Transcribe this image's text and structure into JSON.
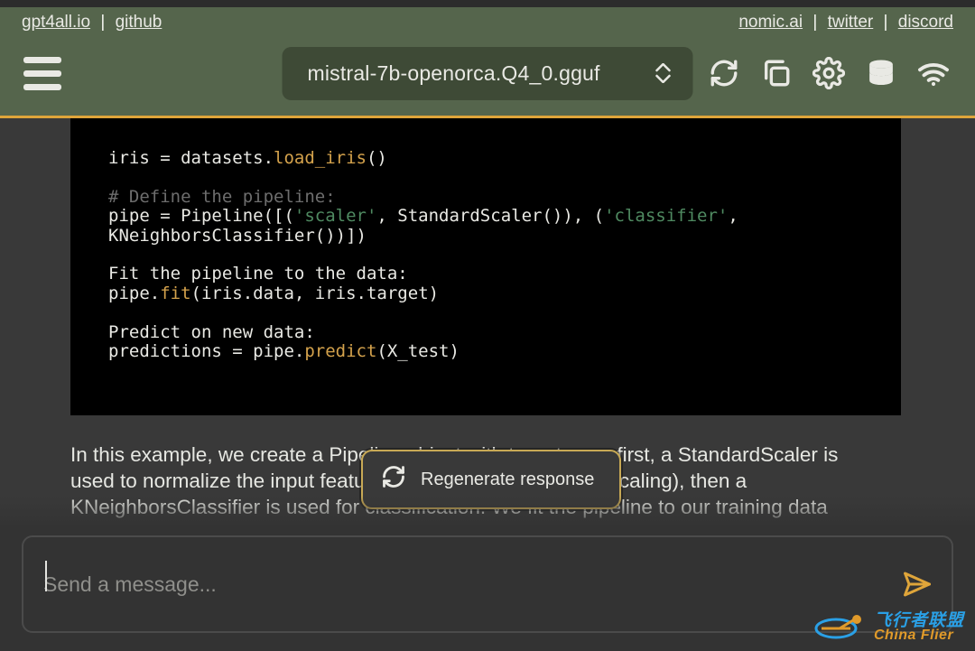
{
  "header": {
    "links_left": [
      {
        "label": "gpt4all.io"
      },
      {
        "label": "github"
      }
    ],
    "links_right": [
      {
        "label": "nomic.ai"
      },
      {
        "label": "twitter"
      },
      {
        "label": "discord"
      }
    ],
    "link_sep": " | ",
    "model_name": "mistral-7b-openorca.Q4_0.gguf",
    "toolbar_icons": [
      "refresh-icon",
      "copy-icon",
      "gear-icon",
      "database-icon",
      "wifi-icon"
    ]
  },
  "code": {
    "l1a": "iris = datasets.",
    "l1b": "load_iris",
    "l1c": "()",
    "l_blank": "",
    "l2": "# Define the pipeline:",
    "l3a": "pipe = Pipeline([(",
    "l3b": "'scaler'",
    "l3c": ", StandardScaler()), (",
    "l3d": "'classifier'",
    "l3e": ",",
    "l4": "KNeighborsClassifier())])",
    "l5": "Fit the pipeline to the data:",
    "l6a": "pipe.",
    "l6b": "fit",
    "l6c": "(iris.data, iris.target)",
    "l7": "Predict on new data:",
    "l8a": "predictions = pipe.",
    "l8b": "predict",
    "l8c": "(X_test)"
  },
  "explain_text": "In this example, we create a Pipeline object with two stages: first, a StandardScaler is used to normalize the input features (also known as feature scaling), then a KNeighborsClassifier is used for classification. We fit the pipeline to our training data and predict on new",
  "regenerate_label": "Regenerate response",
  "input": {
    "placeholder": "Send a message..."
  },
  "brand": {
    "cn": "飞行者联盟",
    "en": "China Flier"
  }
}
